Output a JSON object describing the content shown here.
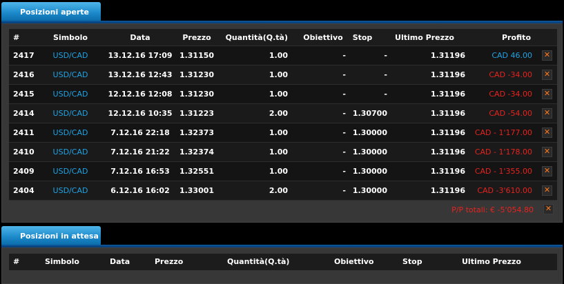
{
  "open_positions": {
    "tab_label": "Posizioni aperte",
    "columns": [
      "#",
      "Simbolo",
      "Data",
      "Prezzo",
      "Quantità(Q.tà)",
      "Obiettivo",
      "Stop",
      "Ultimo Prezzo",
      "Profito"
    ],
    "rows": [
      {
        "id": "2417",
        "symbol": "USD/CAD",
        "date": "13.12.16 17:09",
        "price": "1.31150",
        "qty": "1.00",
        "target": "-",
        "stop": "-",
        "last": "1.31196",
        "profit": "CAD 46.00",
        "profit_sign": "pos"
      },
      {
        "id": "2416",
        "symbol": "USD/CAD",
        "date": "13.12.16 12:43",
        "price": "1.31230",
        "qty": "1.00",
        "target": "-",
        "stop": "-",
        "last": "1.31196",
        "profit": "CAD -34.00",
        "profit_sign": "neg"
      },
      {
        "id": "2415",
        "symbol": "USD/CAD",
        "date": "12.12.16 12:08",
        "price": "1.31230",
        "qty": "1.00",
        "target": "-",
        "stop": "-",
        "last": "1.31196",
        "profit": "CAD -34.00",
        "profit_sign": "neg"
      },
      {
        "id": "2414",
        "symbol": "USD/CAD",
        "date": "12.12.16 10:35",
        "price": "1.31223",
        "qty": "2.00",
        "target": "-",
        "stop": "1.30700",
        "last": "1.31196",
        "profit": "CAD -54.00",
        "profit_sign": "neg"
      },
      {
        "id": "2411",
        "symbol": "USD/CAD",
        "date": "7.12.16 22:18",
        "price": "1.32373",
        "qty": "1.00",
        "target": "-",
        "stop": "1.30000",
        "last": "1.31196",
        "profit": "CAD - 1'177.00",
        "profit_sign": "neg"
      },
      {
        "id": "2410",
        "symbol": "USD/CAD",
        "date": "7.12.16 21:22",
        "price": "1.32374",
        "qty": "1.00",
        "target": "-",
        "stop": "1.30000",
        "last": "1.31196",
        "profit": "CAD - 1'178.00",
        "profit_sign": "neg"
      },
      {
        "id": "2409",
        "symbol": "USD/CAD",
        "date": "7.12.16 16:53",
        "price": "1.32551",
        "qty": "1.00",
        "target": "-",
        "stop": "1.30000",
        "last": "1.31196",
        "profit": "CAD - 1'355.00",
        "profit_sign": "neg"
      },
      {
        "id": "2404",
        "symbol": "USD/CAD",
        "date": "6.12.16 16:02",
        "price": "1.33001",
        "qty": "2.00",
        "target": "-",
        "stop": "1.30000",
        "last": "1.31196",
        "profit": "CAD -3'610.00",
        "profit_sign": "neg"
      }
    ],
    "close_glyph": "✕",
    "total_label": "P/P totali: € -5'054.80"
  },
  "pending_positions": {
    "tab_label": "Posizioni in attesa",
    "columns": [
      "#",
      "Simbolo",
      "Data",
      "Prezzo",
      "Quantità(Q.tà)",
      "Obiettivo",
      "Stop",
      "Ultimo Prezzo"
    ]
  },
  "colors": {
    "tab_blue": "#1d8acb",
    "symbol_blue": "#1fa3e6",
    "loss_red": "#e8231f",
    "close_orange": "#ff7a1a"
  }
}
